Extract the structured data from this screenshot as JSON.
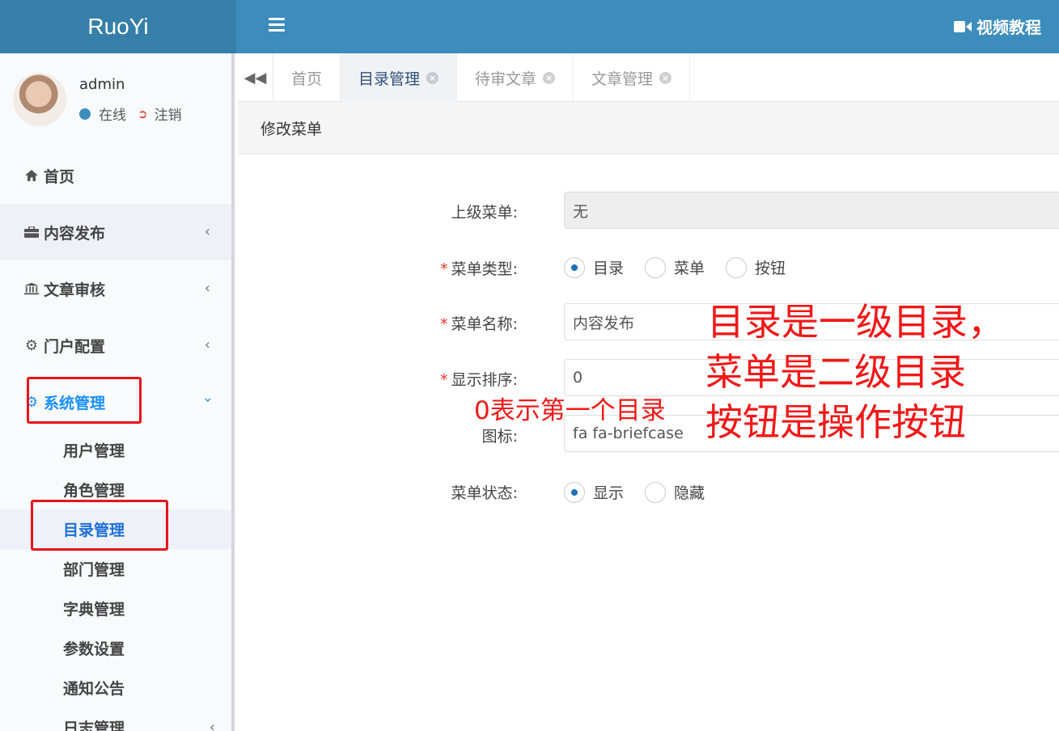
{
  "app": {
    "logo": "RuoYi",
    "video_tutorial": "视频教程"
  },
  "user": {
    "name": "admin",
    "status": "在线",
    "logout": "注销"
  },
  "sidebar": {
    "items": [
      {
        "label": "首页"
      },
      {
        "label": "内容发布"
      },
      {
        "label": "文章审核"
      },
      {
        "label": "门户配置"
      },
      {
        "label": "系统管理"
      }
    ],
    "submenu": [
      {
        "label": "用户管理"
      },
      {
        "label": "角色管理"
      },
      {
        "label": "目录管理"
      },
      {
        "label": "部门管理"
      },
      {
        "label": "字典管理"
      },
      {
        "label": "参数设置"
      },
      {
        "label": "通知公告"
      },
      {
        "label": "日志管理"
      }
    ]
  },
  "tabs": [
    {
      "label": "首页"
    },
    {
      "label": "目录管理"
    },
    {
      "label": "待审文章"
    },
    {
      "label": "文章管理"
    }
  ],
  "panel": {
    "title": "修改菜单"
  },
  "form": {
    "parent_label": "上级菜单:",
    "parent_value": "无",
    "type_label": "菜单类型:",
    "type_options": [
      "目录",
      "菜单",
      "按钮"
    ],
    "type_selected": "目录",
    "name_label": "菜单名称:",
    "name_value": "内容发布",
    "order_label": "显示排序:",
    "order_value": "0",
    "icon_label": "图标:",
    "icon_value": "fa fa-briefcase",
    "status_label": "菜单状态:",
    "status_options": [
      "显示",
      "隐藏"
    ],
    "status_selected": "显示",
    "required_mark": "*"
  },
  "annotations": {
    "order_note": "0表示第一个目录",
    "line1": "目录是一级目录，",
    "line2": "菜单是二级目录",
    "line3": "按钮是操作按钮"
  },
  "colors": {
    "topbar": "#3c8dbc",
    "logo_bar": "#367fa9",
    "annotation": "#f01818",
    "active_blue": "#1890ff"
  }
}
